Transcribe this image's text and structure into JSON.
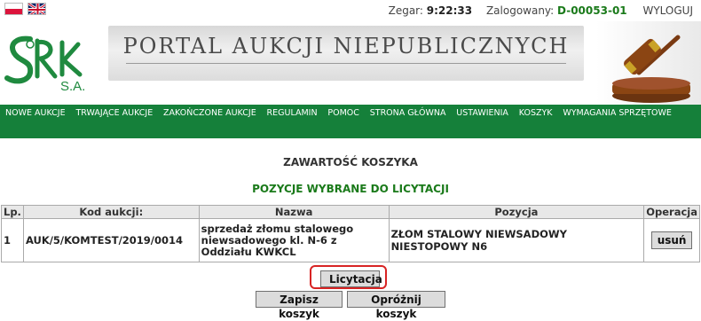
{
  "topbar": {
    "clock_label": "Zegar:",
    "clock_value": "9:22:33",
    "user_label": "Zalogowany:",
    "user_value": "D-00053-01",
    "logout_label": "WYLOGUJ"
  },
  "header": {
    "logo_text": "SRK",
    "logo_subtext": "S.A.",
    "banner_text": "PORTAL AUKCJI NIEPUBLICZNYCH"
  },
  "nav": {
    "items": [
      "NOWE AUKCJE",
      "TRWAJĄCE AUKCJE",
      "ZAKOŃCZONE AUKCJE",
      "REGULAMIN",
      "POMOC",
      "STRONA GŁÓWNA",
      "USTAWIENIA",
      "KOSZYK",
      "WYMAGANIA SPRZĘTOWE"
    ]
  },
  "cart": {
    "title": "ZAWARTOŚĆ KOSZYKA",
    "subtitle": "POZYCJE WYBRANE DO LICYTACJI",
    "columns": [
      "Lp.",
      "Kod aukcji:",
      "Nazwa",
      "Pozycja",
      "Operacja"
    ],
    "rows": [
      {
        "lp": "1",
        "kod": "AUK/5/KOMTEST/2019/0014",
        "nazwa": "sprzedaż złomu stalowego niewsadowego kl. N-6 z Oddziału KWKCL",
        "pozycja": "ZŁOM STALOWY NIEWSADOWY NIESTOPOWY N6",
        "operacja": "usuń"
      }
    ],
    "buttons": {
      "licytacja": "Licytacja",
      "zapisz": "Zapisz koszyk",
      "oproznij": "Opróżnij koszyk"
    }
  },
  "colors": {
    "nav_bg": "#15803a",
    "accent_green": "#1a7a1a",
    "highlight_red": "#d82424"
  }
}
